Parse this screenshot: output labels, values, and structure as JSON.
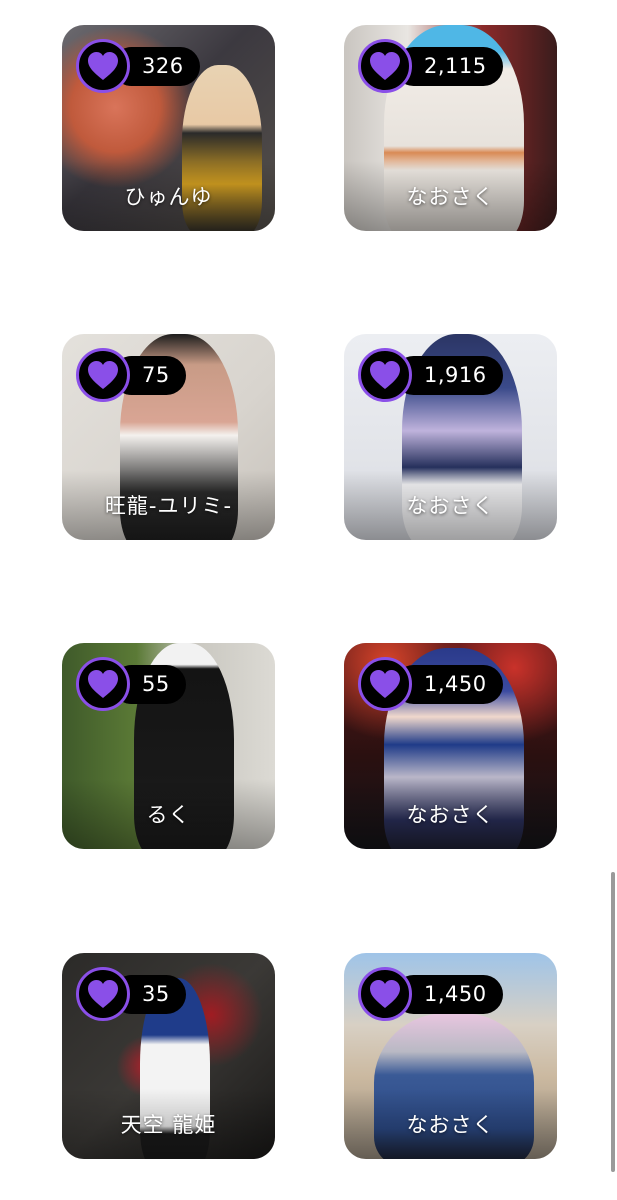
{
  "accent_color": "#8a4fe8",
  "posts": [
    {
      "likes": "326",
      "author": "ひゅんゆ",
      "thumb": "cosplay-photo-1"
    },
    {
      "likes": "2,115",
      "author": "なおさく",
      "thumb": "cosplay-photo-2"
    },
    {
      "likes": "75",
      "author": "旺龍-ユリミ-",
      "thumb": "cosplay-photo-3"
    },
    {
      "likes": "1,916",
      "author": "なおさく",
      "thumb": "cosplay-photo-4"
    },
    {
      "likes": "55",
      "author": "るく",
      "thumb": "cosplay-photo-5"
    },
    {
      "likes": "1,450",
      "author": "なおさく",
      "thumb": "cosplay-photo-6"
    },
    {
      "likes": "35",
      "author": "天空 龍姫",
      "thumb": "cosplay-photo-7"
    },
    {
      "likes": "1,450",
      "author": "なおさく",
      "thumb": "cosplay-photo-8"
    }
  ],
  "icons": {
    "like": "heart-icon"
  }
}
